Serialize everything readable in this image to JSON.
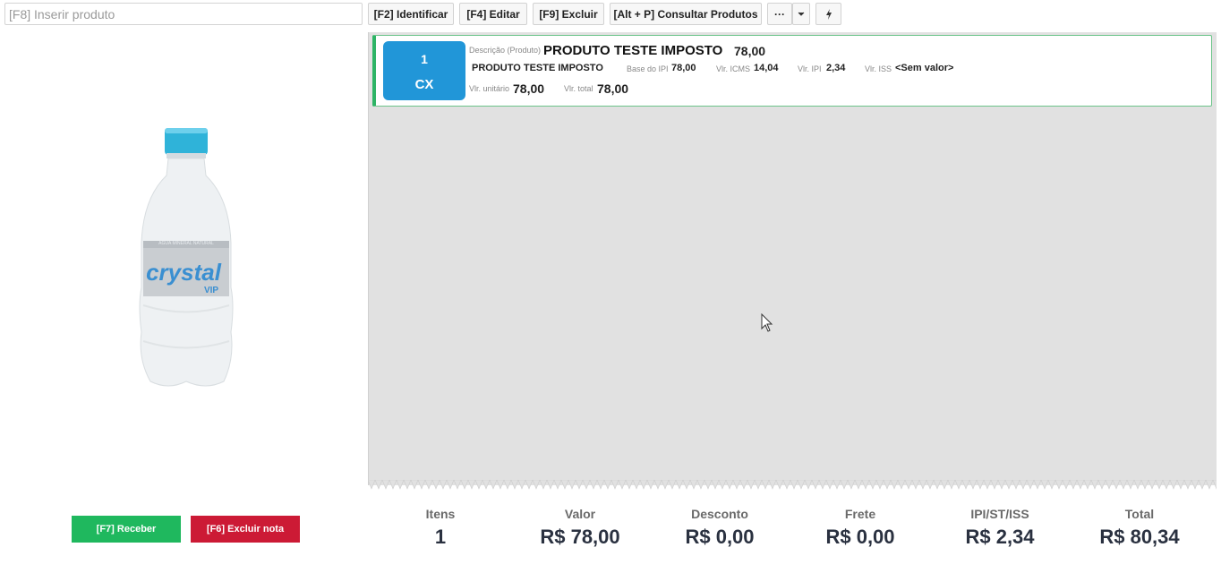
{
  "toolbar": {
    "search_placeholder": "[F8] Inserir produto",
    "identify_label": "[F2] Identificar",
    "edit_label": "[F4] Editar",
    "delete_label": "[F9] Excluir",
    "consult_label": "[Alt + P] Consultar Produtos",
    "more_label": "···",
    "dropdown_icon": "chevron-down-icon",
    "quick_icon": "lightning-icon"
  },
  "product_image": {
    "brand": "crystal",
    "sub": "VIP"
  },
  "item": {
    "quantity": "1",
    "unit": "CX",
    "desc_label": "Descrição (Produto)",
    "desc_value": "PRODUTO TESTE IMPOSTO",
    "desc_price": "78,00",
    "product_name": "PRODUTO TESTE IMPOSTO",
    "base_ipi_label": "Base do IPI",
    "base_ipi_value": "78,00",
    "icms_label": "Vlr. ICMS",
    "icms_value": "14,04",
    "ipi_label": "Vlr. IPI",
    "ipi_value": "2,34",
    "iss_label": "Vlr. ISS",
    "iss_value": "<Sem valor>",
    "unit_price_label": "Vlr. unitário",
    "unit_price_value": "78,00",
    "total_label": "Vlr. total",
    "total_value": "78,00"
  },
  "actions": {
    "receive_label": "[F7] Receber",
    "delete_note_label": "[F6] Excluir nota"
  },
  "summary": {
    "items_label": "Itens",
    "items_value": "1",
    "value_label": "Valor",
    "value_value": "R$ 78,00",
    "discount_label": "Desconto",
    "discount_value": "R$ 0,00",
    "freight_label": "Frete",
    "freight_value": "R$ 0,00",
    "taxes_label": "IPI/ST/ISS",
    "taxes_value": "R$ 2,34",
    "total_label": "Total",
    "total_value": "R$ 80,34"
  },
  "colors": {
    "accent_green": "#1fb85e",
    "accent_red": "#cc1a35",
    "qty_blue": "#2196d8",
    "item_border": "#2db465"
  }
}
